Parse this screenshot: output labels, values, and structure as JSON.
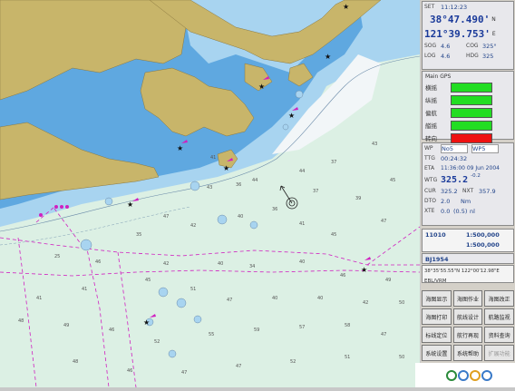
{
  "chart_view": {
    "soundings": [
      "41",
      "36",
      "43",
      "44",
      "44",
      "37",
      "43",
      "45",
      "37",
      "39",
      "36",
      "40",
      "41",
      "45",
      "47",
      "47",
      "42",
      "35",
      "25",
      "46",
      "42",
      "40",
      "34",
      "40",
      "46",
      "49",
      "50",
      "42",
      "40",
      "40",
      "47",
      "51",
      "45",
      "41",
      "41",
      "48",
      "49",
      "46",
      "52",
      "55",
      "59",
      "57",
      "58",
      "47",
      "50",
      "51",
      "52",
      "47",
      "47",
      "46",
      "48"
    ],
    "colors": {
      "land": "#c8b56a",
      "shallow": "#5fa8e0",
      "mid": "#a8d4f0",
      "deep": "#dcf0e4",
      "route": "#d020c0"
    }
  },
  "panel": {
    "set_label": "SET",
    "set_time": "11:12:23",
    "latitude": "38°47.490'",
    "lat_hemi": "N",
    "longitude": "121°39.753'",
    "lon_hemi": "E",
    "sog_label": "SOG",
    "sog_value": "4.6",
    "cog_label": "COG",
    "cog_value": "325°",
    "log_label": "LOG",
    "log_value": "4.6",
    "hdg_label": "HDG",
    "hdg_value": "325",
    "status_title": "Main GPS",
    "status": [
      {
        "label": "横摇",
        "color": "#22dd22"
      },
      {
        "label": "纵摇",
        "color": "#22dd22"
      },
      {
        "label": "偏航",
        "color": "#22dd22"
      },
      {
        "label": "艏摇",
        "color": "#22dd22"
      },
      {
        "label": "转向",
        "color": "#ee1111"
      }
    ],
    "wp_label": "WP",
    "wp_value": "No5",
    "wp_value2": "WP5",
    "ttg_label": "TTG",
    "ttg_value": "00:24:32",
    "eta_label": "ETA",
    "eta_value": "11:36:00 09 Jun 2004",
    "wtg_label": "WTG",
    "wtg_value": "325.2",
    "wtg_sub": "-0.2",
    "cur_label": "CUR",
    "cur_value": "325.2",
    "nxt_label": "NXT",
    "nxt_value": "357.9",
    "dto_label": "DTO",
    "dto_value": "2.0",
    "dto_unit": "Nm",
    "xte_label": "XTE",
    "xte_value": "0.0",
    "xte_limit": "(0.5)",
    "xte_unit": "nl",
    "chart_id": "11010",
    "scale1": "1:500,000",
    "scale2": "1:500,000",
    "datum": "BJ1954",
    "cursor_pos": "38°35'55.55\"N  122°00'12.98\"E",
    "ebl_vrm": "EBL/VRM",
    "buttons": [
      "海图显示",
      "海图作业",
      "海图改正",
      "海图打印",
      "航线设计",
      "航路监视",
      "标线定位",
      "航行再现",
      "资料查询",
      "系统设置",
      "系统帮助",
      "扩展功能"
    ],
    "disabled_buttons": [
      11
    ]
  }
}
